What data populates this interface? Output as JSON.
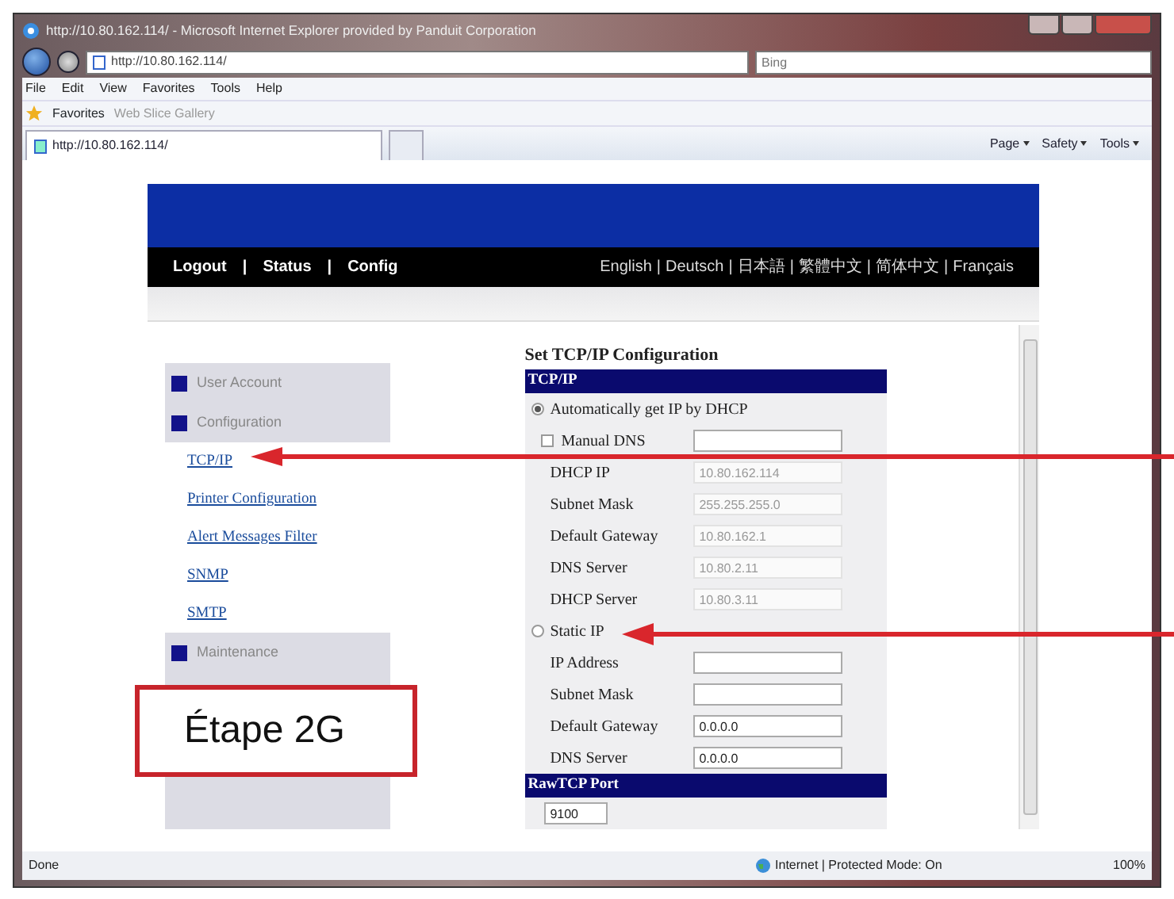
{
  "browser": {
    "title": "http://10.80.162.114/ - Microsoft Internet Explorer provided by Panduit Corporation",
    "address": "http://10.80.162.114/",
    "search": {
      "placeholder": "Bing"
    },
    "menu": [
      "File",
      "Edit",
      "View",
      "Favorites",
      "Tools",
      "Help"
    ],
    "favorites_bar": {
      "favorites": "Favorites",
      "web_slice": "Web Slice Gallery"
    },
    "tab": "http://10.80.162.114/",
    "commands": [
      "Page",
      "Safety",
      "Tools"
    ],
    "status_bar": {
      "status": "Done",
      "zone": "Internet | Protected Mode: On",
      "zoom": "100%"
    }
  },
  "page": {
    "nav_separator": "|",
    "nav": [
      "Logout",
      "Status",
      "Config"
    ],
    "language_separator": "|",
    "languages": [
      "English",
      "Deutsch",
      "日本語",
      "繁體中文",
      "简体中文",
      "Français"
    ],
    "sidebar": [
      {
        "kind": "section",
        "text": "User Account"
      },
      {
        "kind": "section",
        "text": "Configuration"
      },
      {
        "kind": "link",
        "text": "TCP/IP"
      },
      {
        "kind": "link",
        "text": "Printer Configuration"
      },
      {
        "kind": "link",
        "text": "Alert Messages Filter"
      },
      {
        "kind": "link",
        "text": "SNMP"
      },
      {
        "kind": "link",
        "text": "SMTP"
      },
      {
        "kind": "section",
        "text": "Maintenance"
      }
    ],
    "form": {
      "title": "Set TCP/IP Configuration",
      "rows": [
        {
          "kind": "header",
          "text": "TCP/IP"
        },
        {
          "kind": "radio",
          "label": "Automatically get IP by DHCP",
          "selected": true
        },
        {
          "kind": "checkbox",
          "label": "Manual DNS",
          "checked": false
        },
        {
          "kind": "field",
          "label": "DHCP IP",
          "value": "10.80.162.114",
          "disabled": true
        },
        {
          "kind": "field",
          "label": "Subnet Mask",
          "value": "255.255.255.0",
          "disabled": true
        },
        {
          "kind": "field",
          "label": "Default Gateway",
          "value": "10.80.162.1",
          "disabled": true
        },
        {
          "kind": "field",
          "label": "DNS Server",
          "value": "10.80.2.11",
          "disabled": true
        },
        {
          "kind": "field",
          "label": "DHCP Server",
          "value": "10.80.3.11",
          "disabled": true
        },
        {
          "kind": "radio",
          "label": "Static IP",
          "selected": false
        },
        {
          "kind": "field",
          "label": "IP Address",
          "disabled": false
        },
        {
          "kind": "field",
          "label": "Subnet Mask",
          "disabled": false
        },
        {
          "kind": "field",
          "label": "Default Gateway",
          "value": "0.0.0.0",
          "disabled": false
        },
        {
          "kind": "field",
          "label": "DNS Server",
          "value": "0.0.0.0",
          "disabled": false
        },
        {
          "kind": "header",
          "text": "RawTCP Port"
        },
        {
          "kind": "port",
          "value": "9100"
        }
      ]
    }
  },
  "annotation": {
    "label": "Étape 2G"
  }
}
